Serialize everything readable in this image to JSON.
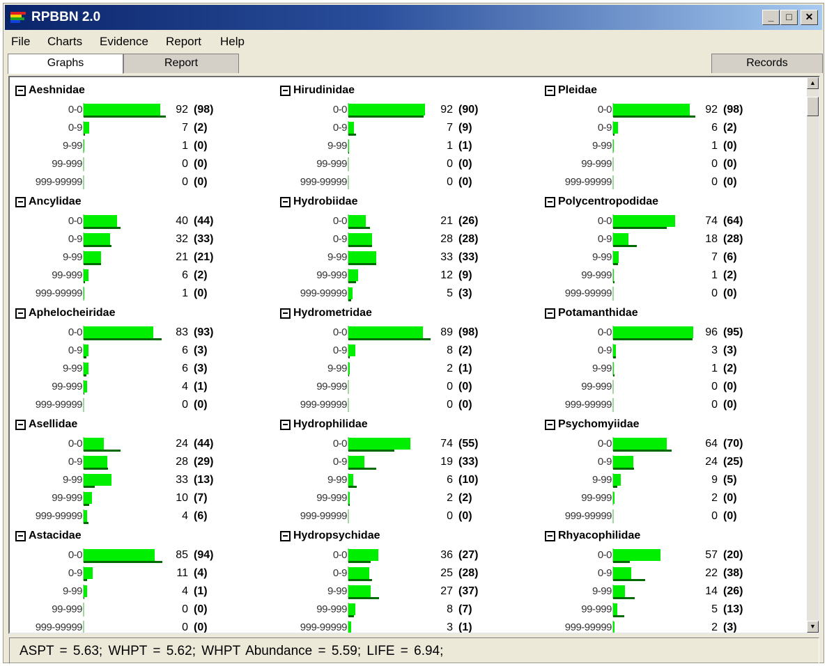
{
  "window": {
    "title": "RPBBN 2.0",
    "controls": {
      "minimize": "_",
      "maximize": "□",
      "close": "✕"
    }
  },
  "menu": [
    "File",
    "Charts",
    "Evidence",
    "Report",
    "Help"
  ],
  "tabs": {
    "graphs": "Graphs",
    "report": "Report",
    "records": "Records",
    "active": "graphs"
  },
  "status": "ASPT = 5.63;   WHPT = 5.62;   WHPT Abundance = 5.59;   LIFE = 6.94;",
  "colors": {
    "bar_bright": "#00ee00",
    "bar_dark": "#006a00"
  },
  "panels": [
    {
      "name": "Aeshnidae",
      "rows": [
        {
          "label": "0-0",
          "value": "92",
          "bracket": "(98)"
        },
        {
          "label": "0-9",
          "value": "7",
          "bracket": "(2)"
        },
        {
          "label": "9-99",
          "value": "1",
          "bracket": "(0)"
        },
        {
          "label": "99-999",
          "value": "0",
          "bracket": "(0)"
        },
        {
          "label": "999-99999",
          "value": "0",
          "bracket": "(0)"
        }
      ]
    },
    {
      "name": "Hirudinidae",
      "rows": [
        {
          "label": "0-0",
          "value": "92",
          "bracket": "(90)"
        },
        {
          "label": "0-9",
          "value": "7",
          "bracket": "(9)"
        },
        {
          "label": "9-99",
          "value": "1",
          "bracket": "(1)"
        },
        {
          "label": "99-999",
          "value": "0",
          "bracket": "(0)"
        },
        {
          "label": "999-99999",
          "value": "0",
          "bracket": "(0)"
        }
      ]
    },
    {
      "name": "Pleidae",
      "rows": [
        {
          "label": "0-0",
          "value": "92",
          "bracket": "(98)"
        },
        {
          "label": "0-9",
          "value": "6",
          "bracket": "(2)"
        },
        {
          "label": "9-99",
          "value": "1",
          "bracket": "(0)"
        },
        {
          "label": "99-999",
          "value": "0",
          "bracket": "(0)"
        },
        {
          "label": "999-99999",
          "value": "0",
          "bracket": "(0)"
        }
      ]
    },
    {
      "name": "Ancylidae",
      "rows": [
        {
          "label": "0-0",
          "value": "40",
          "bracket": "(44)"
        },
        {
          "label": "0-9",
          "value": "32",
          "bracket": "(33)"
        },
        {
          "label": "9-99",
          "value": "21",
          "bracket": "(21)"
        },
        {
          "label": "99-999",
          "value": "6",
          "bracket": "(2)"
        },
        {
          "label": "999-99999",
          "value": "1",
          "bracket": "(0)"
        }
      ]
    },
    {
      "name": "Hydrobiidae",
      "rows": [
        {
          "label": "0-0",
          "value": "21",
          "bracket": "(26)"
        },
        {
          "label": "0-9",
          "value": "28",
          "bracket": "(28)"
        },
        {
          "label": "9-99",
          "value": "33",
          "bracket": "(33)"
        },
        {
          "label": "99-999",
          "value": "12",
          "bracket": "(9)"
        },
        {
          "label": "999-99999",
          "value": "5",
          "bracket": "(3)"
        }
      ]
    },
    {
      "name": "Polycentropodidae",
      "rows": [
        {
          "label": "0-0",
          "value": "74",
          "bracket": "(64)"
        },
        {
          "label": "0-9",
          "value": "18",
          "bracket": "(28)"
        },
        {
          "label": "9-99",
          "value": "7",
          "bracket": "(6)"
        },
        {
          "label": "99-999",
          "value": "1",
          "bracket": "(2)"
        },
        {
          "label": "999-99999",
          "value": "0",
          "bracket": "(0)"
        }
      ]
    },
    {
      "name": "Aphelocheiridae",
      "rows": [
        {
          "label": "0-0",
          "value": "83",
          "bracket": "(93)"
        },
        {
          "label": "0-9",
          "value": "6",
          "bracket": "(3)"
        },
        {
          "label": "9-99",
          "value": "6",
          "bracket": "(3)"
        },
        {
          "label": "99-999",
          "value": "4",
          "bracket": "(1)"
        },
        {
          "label": "999-99999",
          "value": "0",
          "bracket": "(0)"
        }
      ]
    },
    {
      "name": "Hydrometridae",
      "rows": [
        {
          "label": "0-0",
          "value": "89",
          "bracket": "(98)"
        },
        {
          "label": "0-9",
          "value": "8",
          "bracket": "(2)"
        },
        {
          "label": "9-99",
          "value": "2",
          "bracket": "(1)"
        },
        {
          "label": "99-999",
          "value": "0",
          "bracket": "(0)"
        },
        {
          "label": "999-99999",
          "value": "0",
          "bracket": "(0)"
        }
      ]
    },
    {
      "name": "Potamanthidae",
      "rows": [
        {
          "label": "0-0",
          "value": "96",
          "bracket": "(95)"
        },
        {
          "label": "0-9",
          "value": "3",
          "bracket": "(3)"
        },
        {
          "label": "9-99",
          "value": "1",
          "bracket": "(2)"
        },
        {
          "label": "99-999",
          "value": "0",
          "bracket": "(0)"
        },
        {
          "label": "999-99999",
          "value": "0",
          "bracket": "(0)"
        }
      ]
    },
    {
      "name": "Asellidae",
      "rows": [
        {
          "label": "0-0",
          "value": "24",
          "bracket": "(44)"
        },
        {
          "label": "0-9",
          "value": "28",
          "bracket": "(29)"
        },
        {
          "label": "9-99",
          "value": "33",
          "bracket": "(13)"
        },
        {
          "label": "99-999",
          "value": "10",
          "bracket": "(7)"
        },
        {
          "label": "999-99999",
          "value": "4",
          "bracket": "(6)"
        }
      ]
    },
    {
      "name": "Hydrophilidae",
      "rows": [
        {
          "label": "0-0",
          "value": "74",
          "bracket": "(55)"
        },
        {
          "label": "0-9",
          "value": "19",
          "bracket": "(33)"
        },
        {
          "label": "9-99",
          "value": "6",
          "bracket": "(10)"
        },
        {
          "label": "99-999",
          "value": "2",
          "bracket": "(2)"
        },
        {
          "label": "999-99999",
          "value": "0",
          "bracket": "(0)"
        }
      ]
    },
    {
      "name": "Psychomyiidae",
      "rows": [
        {
          "label": "0-0",
          "value": "64",
          "bracket": "(70)"
        },
        {
          "label": "0-9",
          "value": "24",
          "bracket": "(25)"
        },
        {
          "label": "9-99",
          "value": "9",
          "bracket": "(5)"
        },
        {
          "label": "99-999",
          "value": "2",
          "bracket": "(0)"
        },
        {
          "label": "999-99999",
          "value": "0",
          "bracket": "(0)"
        }
      ]
    },
    {
      "name": "Astacidae",
      "rows": [
        {
          "label": "0-0",
          "value": "85",
          "bracket": "(94)"
        },
        {
          "label": "0-9",
          "value": "11",
          "bracket": "(4)"
        },
        {
          "label": "9-99",
          "value": "4",
          "bracket": "(1)"
        },
        {
          "label": "99-999",
          "value": "0",
          "bracket": "(0)"
        },
        {
          "label": "999-99999",
          "value": "0",
          "bracket": "(0)"
        }
      ]
    },
    {
      "name": "Hydropsychidae",
      "rows": [
        {
          "label": "0-0",
          "value": "36",
          "bracket": "(27)"
        },
        {
          "label": "0-9",
          "value": "25",
          "bracket": "(28)"
        },
        {
          "label": "9-99",
          "value": "27",
          "bracket": "(37)"
        },
        {
          "label": "99-999",
          "value": "8",
          "bracket": "(7)"
        },
        {
          "label": "999-99999",
          "value": "3",
          "bracket": "(1)"
        }
      ]
    },
    {
      "name": "Rhyacophilidae",
      "rows": [
        {
          "label": "0-0",
          "value": "57",
          "bracket": "(20)"
        },
        {
          "label": "0-9",
          "value": "22",
          "bracket": "(38)"
        },
        {
          "label": "9-99",
          "value": "14",
          "bracket": "(26)"
        },
        {
          "label": "99-999",
          "value": "5",
          "bracket": "(13)"
        },
        {
          "label": "999-99999",
          "value": "2",
          "bracket": "(3)"
        }
      ]
    }
  ]
}
